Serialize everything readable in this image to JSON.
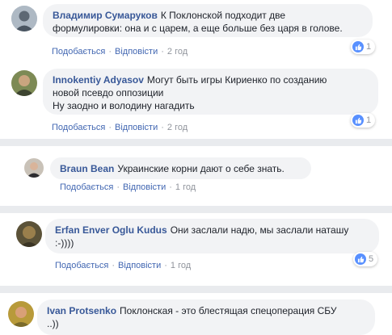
{
  "actions": {
    "like": "Подобається",
    "reply": "Відповісти",
    "separator": "·"
  },
  "comments": [
    {
      "author": "Владимир Сумаруков",
      "text_lines": [
        "К Поклонской подходит две",
        "формулировки: она и с царем, а еще больше без царя в голове."
      ],
      "time": "2 год",
      "reactions": "1"
    },
    {
      "author": "Innokentiy Adyasov",
      "text_lines": [
        "Могут быть игры Кириенко по созданию",
        "новой псевдо оппозиции",
        "Ну заодно и володину нагадить"
      ],
      "time": "2 год",
      "reactions": "1"
    },
    {
      "author": "Braun Bean",
      "text_lines": [
        "Украинские корни дают о себе знать."
      ],
      "time": "1 год",
      "reactions": ""
    },
    {
      "author": "Erfan Enver Oglu Kudus",
      "text_lines": [
        "Они заслали надю, мы заслали наташу",
        ":-))))"
      ],
      "time": "1 год",
      "reactions": "5"
    },
    {
      "author": "Ivan Protsenko",
      "text_lines": [
        "Поклонская - это блестящая спецоперация СБУ",
        "..))"
      ],
      "time": "",
      "reactions": ""
    }
  ],
  "colors": {
    "author": "#385898",
    "link": "#4267b2",
    "bubble": "#f2f3f5",
    "meta": "#90949c",
    "like": "#5890ff"
  }
}
